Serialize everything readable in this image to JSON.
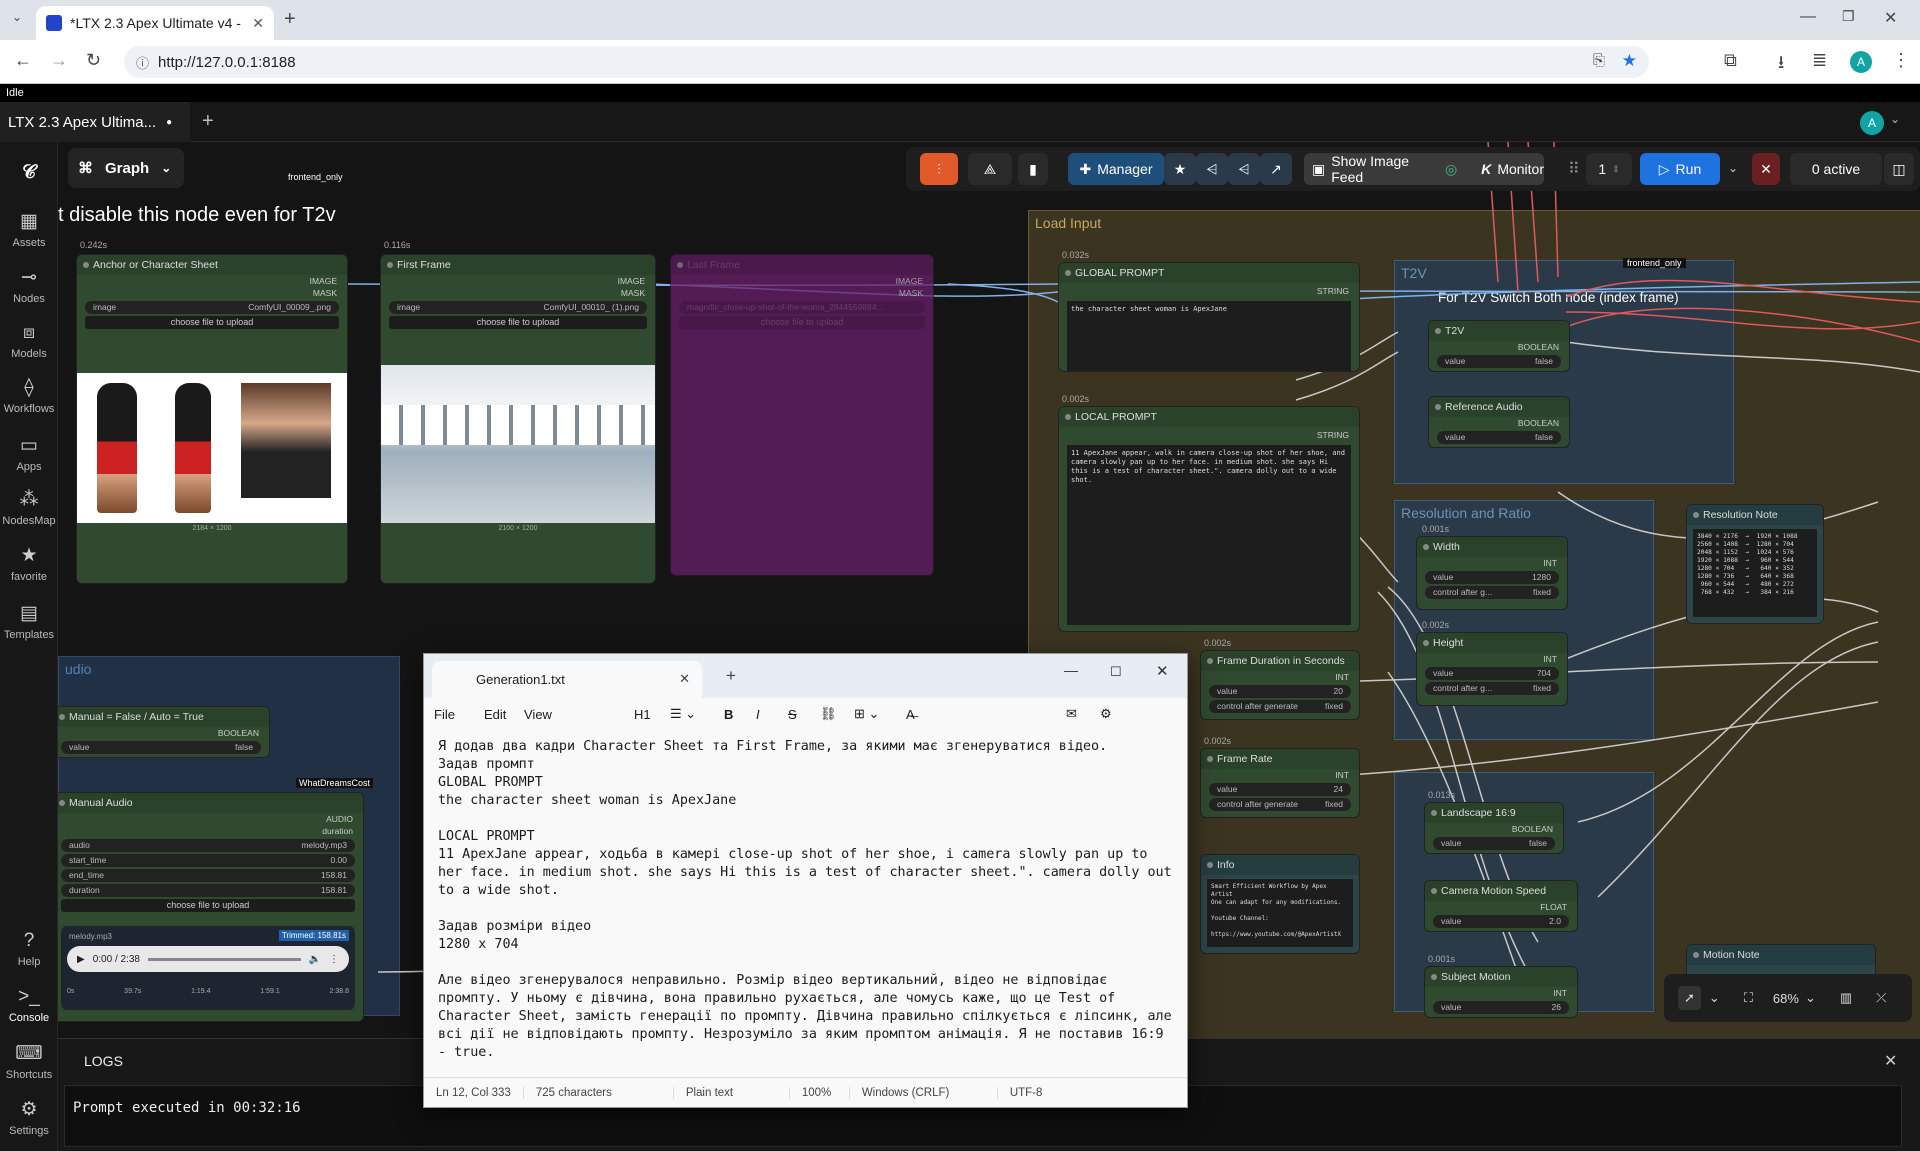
{
  "browser": {
    "tab_title": "*LTX 2.3 Apex Ultimate v4 - Cor",
    "url": "http://127.0.0.1:8188",
    "avatar_letter": "A"
  },
  "app": {
    "status": "Idle",
    "workflow_tab": "LTX 2.3 Apex Ultima...",
    "graph_label": "Graph",
    "frontend_tag": "frontend_only",
    "avatar_letter": "A"
  },
  "sidebar": {
    "items": [
      {
        "label": "Assets",
        "icon": "assets-icon"
      },
      {
        "label": "Nodes",
        "icon": "nodes-icon"
      },
      {
        "label": "Models",
        "icon": "models-icon"
      },
      {
        "label": "Workflows",
        "icon": "workflows-icon"
      },
      {
        "label": "Apps",
        "icon": "apps-icon"
      },
      {
        "label": "NodesMap",
        "icon": "nodesmap-icon"
      },
      {
        "label": "favorite",
        "icon": "star-icon"
      },
      {
        "label": "Templates",
        "icon": "templates-icon"
      }
    ],
    "bottom": [
      {
        "label": "Help",
        "icon": "help-icon"
      },
      {
        "label": "Console",
        "icon": "console-icon"
      },
      {
        "label": "Shortcuts",
        "icon": "keyboard-icon"
      },
      {
        "label": "Settings",
        "icon": "gear-icon"
      }
    ]
  },
  "toolbar": {
    "manager": "Manager",
    "show_image_feed": "Show Image Feed",
    "monitor": "Monitor",
    "queue_count": "1",
    "run": "Run",
    "active": "0 active"
  },
  "canvas": {
    "heading": "t disable this node even for T2v",
    "groups": {
      "load_input": "Load Input",
      "t2v": "T2V",
      "t2v_note": "For T2V Switch Both node (index frame)",
      "resolution": "Resolution and Ratio",
      "audio": "udio"
    },
    "nodes": {
      "anchor": {
        "time": "0.242s",
        "title": "Anchor or Character Sheet",
        "out1": "IMAGE",
        "out2": "MASK",
        "image_label": "image",
        "image_value": "ComfyUI_00009_.png",
        "upload": "choose file to upload",
        "size": "2184 × 1200"
      },
      "first": {
        "time": "0.116s",
        "title": "First Frame",
        "out1": "IMAGE",
        "out2": "MASK",
        "image_label": "image",
        "image_value": "ComfyUI_00010_ (1).png",
        "upload": "choose file to upload",
        "size": "2100 × 1200"
      },
      "last": {
        "title": "Last Frame",
        "out1": "IMAGE",
        "out2": "MASK",
        "image_value": "magnific_close-up-shot-of-the-woma_2844559884...",
        "upload": "choose file to upload"
      },
      "global_prompt": {
        "time": "0.032s",
        "title": "GLOBAL PROMPT",
        "out": "STRING",
        "text": "the character sheet woman is ApexJane"
      },
      "local_prompt": {
        "time": "0.002s",
        "title": "LOCAL PROMPT",
        "out": "STRING",
        "text": "11 ApexJane appear, walk in camera close-up shot of her shoe, and camera slowly pan up to her face. in medium shot. she says Hi this is a test of character sheet.\". camera dolly out to a wide shot."
      },
      "t2v": {
        "title": "T2V",
        "out": "BOOLEAN",
        "label": "value",
        "value": "false"
      },
      "ref_audio": {
        "title": "Reference Audio",
        "out": "BOOLEAN",
        "label": "value",
        "value": "false"
      },
      "res_note": {
        "title": "Resolution Note",
        "text": "3840 × 2176  →  1920 × 1088\n2560 × 1408  →  1280 × 704\n2048 × 1152  →  1024 × 576\n1920 × 1088  →   960 × 544\n1280 × 704   →   640 × 352\n1280 × 736   →   640 × 368\n 960 × 544   →   480 × 272\n 768 × 432   →   384 × 216"
      },
      "width": {
        "time": "0.001s",
        "title": "Width",
        "out": "INT",
        "label": "value",
        "value": "1280",
        "ctrl": "control after g...",
        "ctrl_val": "fixed"
      },
      "height": {
        "time": "0.002s",
        "title": "Height",
        "out": "INT",
        "label": "value",
        "value": "704",
        "ctrl": "control after g...",
        "ctrl_val": "fixed"
      },
      "duration": {
        "time": "0.002s",
        "title": "Frame Duration in Seconds",
        "out": "INT",
        "label": "value",
        "value": "20",
        "ctrl": "control after generate",
        "ctrl_val": "fixed"
      },
      "framerate": {
        "time": "0.002s",
        "title": "Frame Rate",
        "out": "INT",
        "label": "value",
        "value": "24",
        "ctrl": "control after generate",
        "ctrl_val": "fixed"
      },
      "landscape": {
        "time": "0.013s",
        "title": "Landscape 16:9",
        "out": "BOOLEAN",
        "label": "value",
        "value": "false"
      },
      "info": {
        "title": "Info",
        "text": "Smart Efficient Workflow by Apex Artist\nOne can adapt for any modifications.\n\nYoutube Channel:\n\nhttps://www.youtube.com/@ApexArtistX"
      },
      "motion_speed": {
        "title": "Camera Motion Speed",
        "out": "FLOAT",
        "label": "value",
        "value": "2.0"
      },
      "subject_motion": {
        "time": "0.001s",
        "title": "Subject Motion",
        "out": "INT",
        "label": "value",
        "value": "26"
      },
      "motion_note": {
        "title": "Motion Note"
      },
      "manual_switch": {
        "title": "Manual = False  /  Auto = True",
        "out": "BOOLEAN",
        "label": "value",
        "value": "false"
      },
      "manual_audio": {
        "title": "Manual Audio",
        "badge": "WhatDreamsCost",
        "out1": "AUDIO",
        "out2": "duration",
        "audio_label": "audio",
        "audio_value": "melody.mp3",
        "start_label": "start_time",
        "start_value": "0.00",
        "end_label": "end_time",
        "end_value": "158.81",
        "dur_label": "duration",
        "dur_value": "158.81",
        "upload": "choose file to upload",
        "file": "melody.mp3",
        "trimmed": "Trimmed: 158.81s",
        "player_time": "0:00 / 2:38",
        "ticks": [
          "0s",
          "39.7s",
          "1:19.4",
          "1:59.1",
          "2:38.8"
        ]
      }
    }
  },
  "notepad": {
    "filename": "Generation1.txt",
    "menu": [
      "File",
      "Edit",
      "View"
    ],
    "heading_sel": "H1",
    "body": "Я додав два кадри Character Sheet та First Frame, за якими має згенеруватися відео.\nЗадав промпт\nGLOBAL PROMPT\nthe character sheet woman is ApexJane\n\nLOCAL PROMPT\n11 ApexJane appear, ходьба в камері close-up shot of her shoe, і camera slowly pan up to her face. in medium shot. she says Hi this is a test of character sheet.\". camera dolly out to a wide shot.\n\nЗадав розміри відео\n1280 x 704\n\nАле відео згенерувалося неправильно. Розмір відео вертикальний, відео не відповідає промпту. У ньому є дівчина, вона правильно рухається, але чомусь каже, що це Test of Character Sheet, замість генерації по промпту. Дівчина правильно спілкується є ліпсинк, але всі дії не відповідають промпту. Незрозуміло за яким промптом анімація. Я не поставив 16:9 - true.",
    "status": {
      "pos": "Ln 12, Col 333",
      "chars": "725 characters",
      "format": "Plain text",
      "zoom": "100%",
      "eol": "Windows (CRLF)",
      "enc": "UTF-8"
    }
  },
  "logs": {
    "title": "LOGS",
    "line": "Prompt executed in 00:32:16"
  },
  "zoom": {
    "level": "68%"
  },
  "colors": {
    "accent": "#1a73e8",
    "run": "#1e73e0",
    "group_load": "#6b5a2a",
    "group_t2v": "#3d5d78",
    "node_green": "#2f4a2f",
    "node_purple": "#6a1f6a"
  }
}
